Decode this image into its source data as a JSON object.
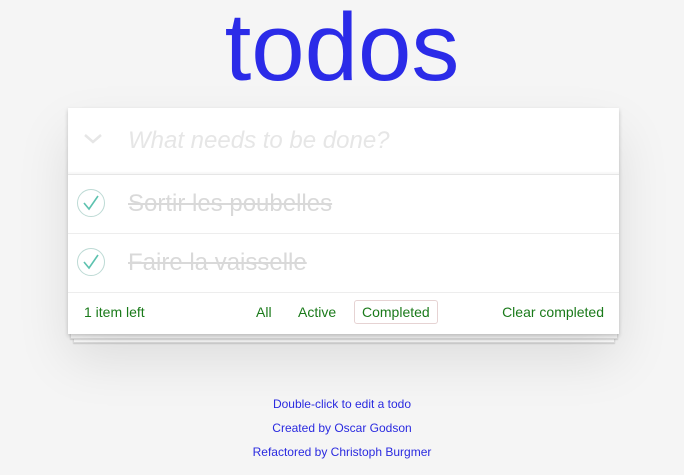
{
  "app": {
    "title": "todos",
    "title_color": "#2b2be8"
  },
  "new_todo": {
    "placeholder": "What needs to be done?",
    "toggle_icon": "chevron-down-icon"
  },
  "todos": [
    {
      "label": "Sortir les poubelles",
      "completed": true,
      "check_icon": "checkmark-icon"
    },
    {
      "label": "Faire la vaisselle",
      "completed": true,
      "check_icon": "checkmark-icon"
    }
  ],
  "footer": {
    "count_label": "1 item left",
    "filters": [
      "All",
      "Active",
      "Completed"
    ],
    "selected_filter": "Completed",
    "clear_label": "Clear completed",
    "text_color": "#1a7a1a"
  },
  "info": {
    "line1": "Double-click to edit a todo",
    "line2": "Created by Oscar Godson",
    "line3": "Refactored by Christoph Burgmer",
    "color": "#2a2ae0"
  }
}
